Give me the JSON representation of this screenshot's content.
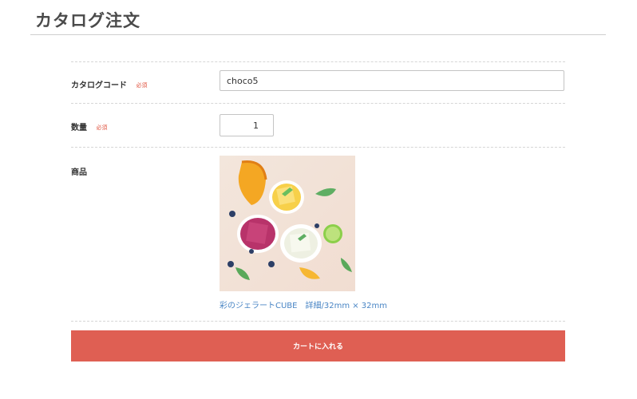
{
  "page": {
    "title": "カタログ注文"
  },
  "form": {
    "catalog_code": {
      "label": "カタログコード",
      "required_badge": "必須",
      "value": "choco5"
    },
    "quantity": {
      "label": "数量",
      "required_badge": "必須",
      "value": "1"
    },
    "product": {
      "label": "商品",
      "image_alt": "彩のジェラートCUBE",
      "link_text": "彩のジェラートCUBE　詳細/32mm × 32mm"
    }
  },
  "actions": {
    "add_to_cart_label": "カートに入れる"
  },
  "colors": {
    "accent_button": "#df5f53",
    "required_badge": "#e0533f",
    "link": "#4a86c5"
  }
}
